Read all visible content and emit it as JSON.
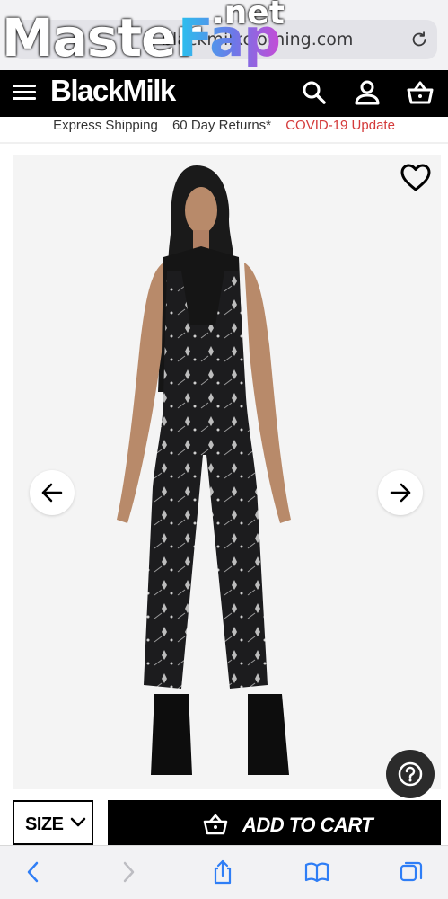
{
  "browser": {
    "url": "blackmilkclothing.com",
    "watermark": {
      "part1": "Master",
      "part2": "Fap",
      "suffix": ".net"
    }
  },
  "header": {
    "brand": "BlackMilk",
    "icons": [
      "menu-icon",
      "search-icon",
      "user-icon",
      "basket-icon"
    ]
  },
  "info_bar": {
    "shipping": "Express Shipping",
    "returns": "60 Day Returns*",
    "covid": "COVID-19 Update"
  },
  "product": {
    "image_alt": "Model wearing black patterned overalls",
    "wishlist_icon": "heart-icon",
    "prev_icon": "arrow-left-icon",
    "next_icon": "arrow-right-icon"
  },
  "purchase": {
    "size_label": "SIZE",
    "add_to_cart_label": "ADD TO CART"
  },
  "help": {
    "icon": "question-icon"
  },
  "toolbar": {
    "icons": [
      "back-icon",
      "forward-icon",
      "share-icon",
      "bookmarks-icon",
      "tabs-icon"
    ]
  },
  "colors": {
    "header_bg": "#000000",
    "covid": "#d43a3a",
    "accent_fap": "#27c3ee"
  }
}
